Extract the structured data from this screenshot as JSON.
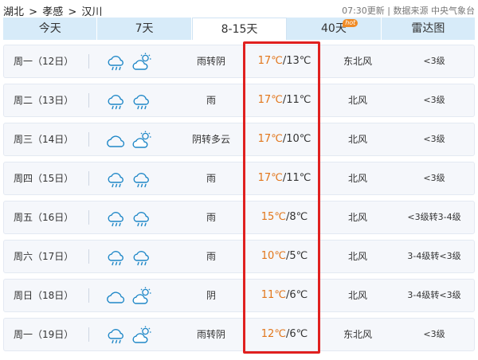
{
  "breadcrumb": [
    "湖北",
    ">",
    "孝感",
    ">",
    "汉川"
  ],
  "update_info": "07:30更新 | 数据来源 中央气象台",
  "tabs": [
    {
      "label": "今天",
      "active": false
    },
    {
      "label": "7天",
      "active": false
    },
    {
      "label": "8-15天",
      "active": true
    },
    {
      "label": "40天",
      "active": false,
      "badge": "hot"
    },
    {
      "label": "雷达图",
      "active": false
    }
  ],
  "colors": {
    "accent_temp": "#e2761b",
    "highlight_border": "#e0201f",
    "tab_bg": "#d7ebf9",
    "icon_stroke": "#1e87c7"
  },
  "forecast": [
    {
      "day": "周一（12日）",
      "icons": [
        "rain-cloud-icon",
        "partly-cloudy-icon"
      ],
      "desc": "雨转阴",
      "hi": "17℃",
      "lo": "/13℃",
      "wind": "东北风",
      "level": "<3级"
    },
    {
      "day": "周二（13日）",
      "icons": [
        "rain-cloud-icon",
        "rain-cloud-icon"
      ],
      "desc": "雨",
      "hi": "17℃",
      "lo": "/11℃",
      "wind": "北风",
      "level": "<3级"
    },
    {
      "day": "周三（14日）",
      "icons": [
        "overcast-cloud-icon",
        "partly-cloudy-icon"
      ],
      "desc": "阴转多云",
      "hi": "17℃",
      "lo": "/10℃",
      "wind": "北风",
      "level": "<3级"
    },
    {
      "day": "周四（15日）",
      "icons": [
        "rain-cloud-icon",
        "rain-cloud-icon"
      ],
      "desc": "雨",
      "hi": "17℃",
      "lo": "/11℃",
      "wind": "北风",
      "level": "<3级"
    },
    {
      "day": "周五（16日）",
      "icons": [
        "rain-cloud-icon",
        "rain-cloud-icon"
      ],
      "desc": "雨",
      "hi": "15℃",
      "lo": "/8℃",
      "wind": "北风",
      "level": "<3级转3-4级"
    },
    {
      "day": "周六（17日）",
      "icons": [
        "rain-cloud-icon",
        "rain-cloud-icon"
      ],
      "desc": "雨",
      "hi": "10℃",
      "lo": "/5℃",
      "wind": "北风",
      "level": "3-4级转<3级"
    },
    {
      "day": "周日（18日）",
      "icons": [
        "overcast-cloud-icon",
        "partly-cloudy-icon"
      ],
      "desc": "阴",
      "hi": "11℃",
      "lo": "/6℃",
      "wind": "北风",
      "level": "3-4级转<3级"
    },
    {
      "day": "周一（19日）",
      "icons": [
        "rain-cloud-icon",
        "partly-cloudy-icon"
      ],
      "desc": "雨转阴",
      "hi": "12℃",
      "lo": "/6℃",
      "wind": "东北风",
      "level": "<3级"
    }
  ]
}
